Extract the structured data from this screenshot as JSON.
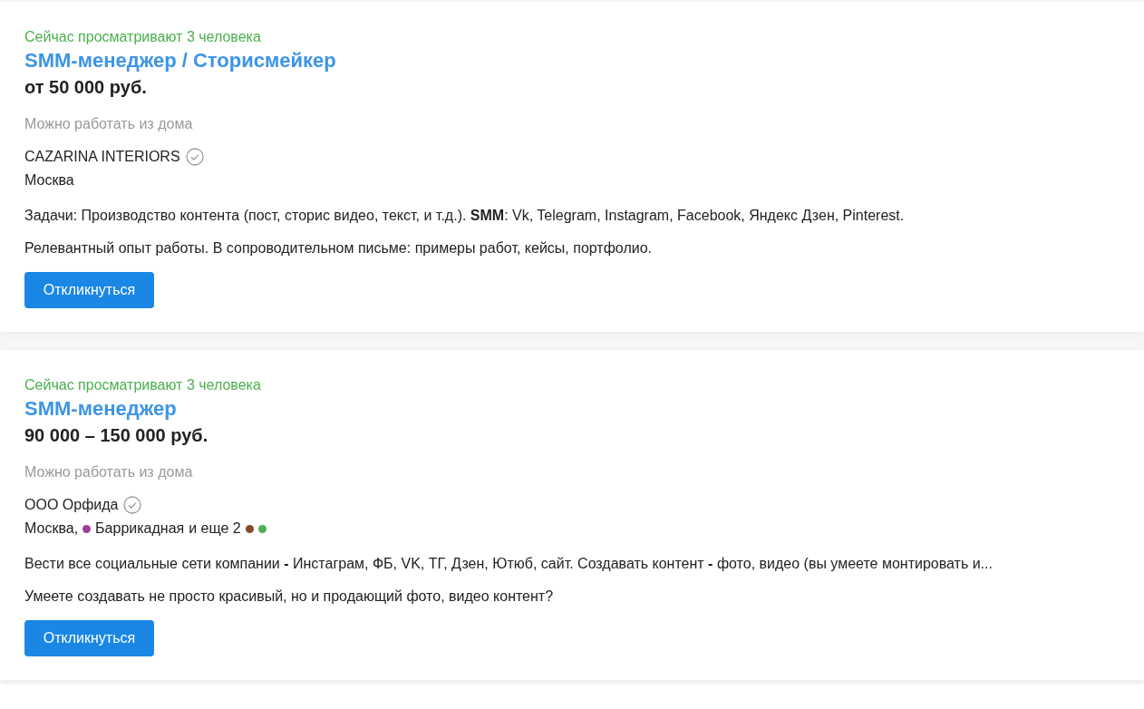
{
  "vacancies": [
    {
      "viewers": "Сейчас просматривают 3 человека",
      "title": "SMM-менеджер / Сторисмейкер",
      "salary": "от 50 000 руб.",
      "remote": "Можно работать из дома",
      "company": "CAZARINA INTERIORS",
      "verified": true,
      "location": {
        "city": "Москва"
      },
      "description": [
        "Задачи: Производство контента (пост, сторис видео, текст, и т.д.). **SMM**: Vk, Telegram, Instagram, Facebook, Яндекс Дзен, Pinterest.",
        "Релевантный опыт работы. В сопроводительном письме: примеры работ, кейсы, портфолио."
      ],
      "button": "Откликнуться"
    },
    {
      "viewers": "Сейчас просматривают 3 человека",
      "title": "SMM-менеджер",
      "salary": "90 000 – 150 000 руб.",
      "remote": "Можно работать из дома",
      "company": "ООО Орфида",
      "verified": true,
      "location": {
        "city": "Москва,",
        "metro": [
          {
            "name": "Баррикадная",
            "color": "#9b3f9b"
          }
        ],
        "more": "и еще 2",
        "more_dots": [
          {
            "color": "#8b4a2b"
          },
          {
            "color": "#4caf50"
          }
        ]
      },
      "description": [
        "Вести все социальные сети компании **-** Инстаграм, ФБ, VK, ТГ, Дзен, Ютюб, сайт. Создавать контент **-** фото, видео (вы умеете монтировать и...",
        "Умеете создавать не просто красивый, но и продающий фото, видео контент?"
      ],
      "button": "Откликнуться"
    }
  ]
}
